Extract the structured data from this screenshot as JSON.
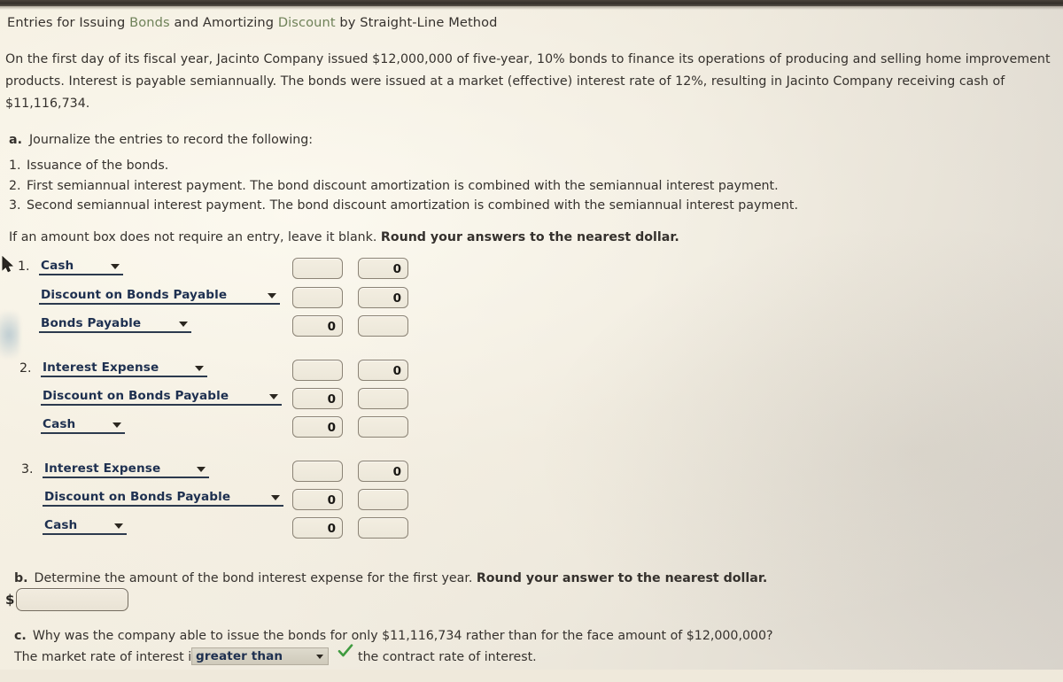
{
  "title": {
    "part1": "Entries for Issuing ",
    "link1": "Bonds",
    "part2": " and Amortizing ",
    "link2": "Discount",
    "part3": " by Straight-Line Method"
  },
  "problem": {
    "paragraph": "On the first day of its fiscal year, Jacinto Company issued $12,000,000 of five-year, 10% bonds to finance its operations of producing and selling home improvement products. Interest is payable semiannually. The bonds were issued at a market (effective) interest rate of 12%, resulting in Jacinto Company receiving cash of $11,116,734."
  },
  "part_a": {
    "marker": "a.",
    "prompt": "Journalize the entries to record the following:",
    "items": [
      {
        "num": "1.",
        "text": "Issuance of the bonds."
      },
      {
        "num": "2.",
        "text": "First semiannual interest payment. The bond discount amortization is combined with the semiannual interest payment."
      },
      {
        "num": "3.",
        "text": "Second semiannual interest payment. The bond discount amortization is combined with the semiannual interest payment."
      }
    ],
    "note_plain": "If an amount box does not require an entry, leave it blank. ",
    "note_bold": "Round your answers to the nearest dollar.",
    "entries": [
      {
        "num": "1.",
        "rows": [
          {
            "account": "Cash",
            "debit": "",
            "credit": "0"
          },
          {
            "account": "Discount on Bonds Payable",
            "debit": "",
            "credit": "0"
          },
          {
            "account": "Bonds Payable",
            "debit": "0",
            "credit": ""
          }
        ]
      },
      {
        "num": "2.",
        "rows": [
          {
            "account": "Interest Expense",
            "debit": "",
            "credit": "0"
          },
          {
            "account": "Discount on Bonds Payable",
            "debit": "0",
            "credit": ""
          },
          {
            "account": "Cash",
            "debit": "0",
            "credit": ""
          }
        ]
      },
      {
        "num": "3.",
        "rows": [
          {
            "account": "Interest Expense",
            "debit": "",
            "credit": "0"
          },
          {
            "account": "Discount on Bonds Payable",
            "debit": "0",
            "credit": ""
          },
          {
            "account": "Cash",
            "debit": "0",
            "credit": ""
          }
        ]
      }
    ]
  },
  "part_b": {
    "marker": "b.",
    "prompt_plain": "Determine the amount of the bond interest expense for the first year. ",
    "prompt_bold": "Round your answer to the nearest dollar.",
    "currency_symbol": "$",
    "answer_value": "",
    "answer_placeholder": ""
  },
  "part_c": {
    "marker": "c.",
    "prompt": "Why was the company able to issue the bonds for only $11,116,734 rather than for the face amount of $12,000,000?",
    "sentence_start": "The market rate of interest is",
    "selected_option": "greater than",
    "sentence_end": "the contract rate of interest.",
    "validation_icon": "check-icon"
  },
  "colors": {
    "page_background": "#efe9db",
    "glossary_link": "#6f8259",
    "account_text": "#1e3050",
    "check_green": "#3f9b3f",
    "body_text": "#35312d"
  },
  "cursor": {
    "icon": "mouse-pointer-icon"
  }
}
